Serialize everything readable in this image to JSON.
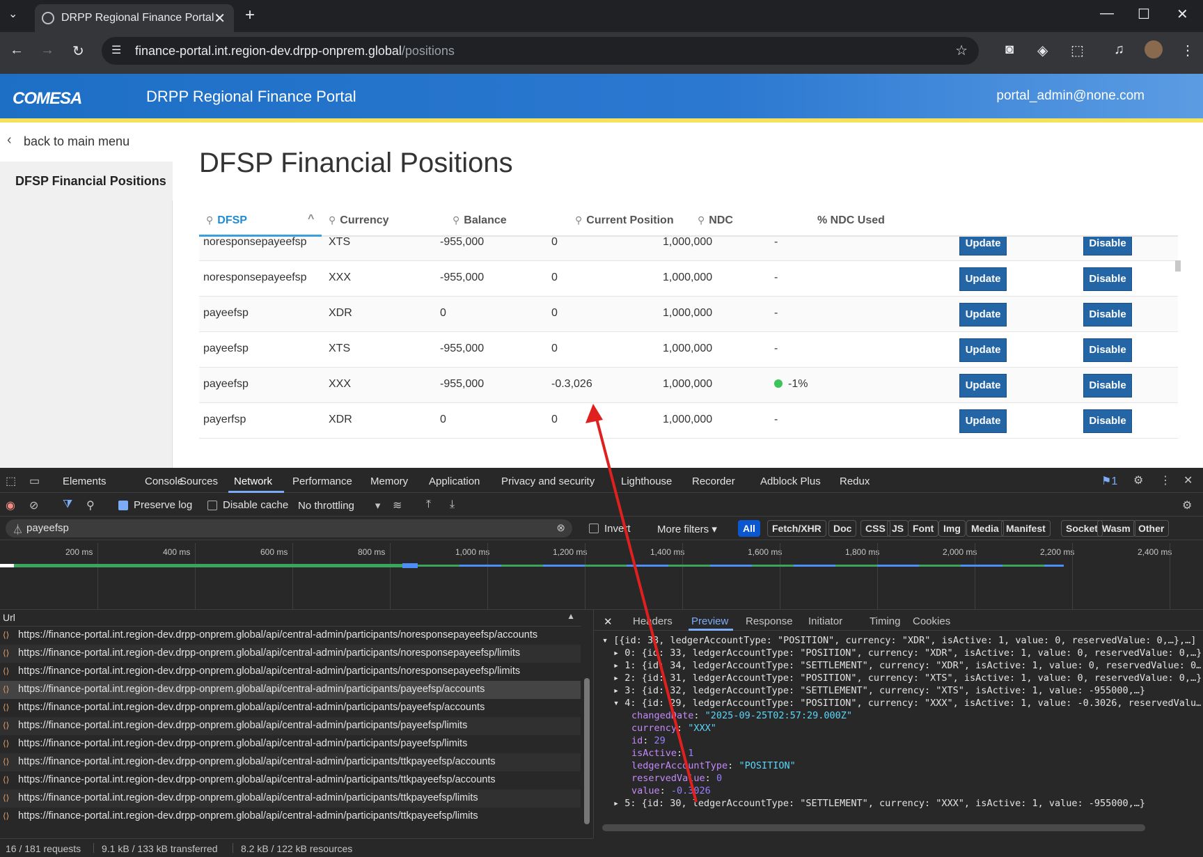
{
  "browser": {
    "tab_title": "DRPP Regional Finance Portal",
    "url_host": "finance-portal.int.region-dev.drpp-onprem.global",
    "url_path": "/positions"
  },
  "header": {
    "logo_text": "COMESA",
    "title": "DRPP Regional Finance Portal",
    "user": "portal_admin@none.com"
  },
  "sidebar": {
    "back_label": "back to main menu",
    "active_item": "DFSP Financial Positions"
  },
  "page": {
    "title": "DFSP Financial Positions"
  },
  "table": {
    "columns": [
      "DFSP",
      "Currency",
      "Balance",
      "Current Position",
      "NDC",
      "% NDC Used"
    ],
    "update_label": "Update",
    "disable_label": "Disable",
    "rows": [
      {
        "dfsp": "noresponsepayeefsp",
        "currency": "XTS",
        "balance": "-955,000",
        "position": "0",
        "ndc": "1,000,000",
        "ndc_used": "-"
      },
      {
        "dfsp": "noresponsepayeefsp",
        "currency": "XXX",
        "balance": "-955,000",
        "position": "0",
        "ndc": "1,000,000",
        "ndc_used": "-"
      },
      {
        "dfsp": "payeefsp",
        "currency": "XDR",
        "balance": "0",
        "position": "0",
        "ndc": "1,000,000",
        "ndc_used": "-"
      },
      {
        "dfsp": "payeefsp",
        "currency": "XTS",
        "balance": "-955,000",
        "position": "0",
        "ndc": "1,000,000",
        "ndc_used": "-"
      },
      {
        "dfsp": "payeefsp",
        "currency": "XXX",
        "balance": "-955,000",
        "position": "-0.3,026",
        "ndc": "1,000,000",
        "ndc_used": "-1%"
      },
      {
        "dfsp": "payerfsp",
        "currency": "XDR",
        "balance": "0",
        "position": "0",
        "ndc": "1,000,000",
        "ndc_used": "-"
      }
    ]
  },
  "devtools": {
    "tabs": [
      "Elements",
      "Console",
      "Sources",
      "Network",
      "Performance",
      "Memory",
      "Application",
      "Privacy and security",
      "Lighthouse",
      "Recorder",
      "Adblock Plus",
      "Redux"
    ],
    "active_tab": "Network",
    "issues_count": "1",
    "preserve_log": "Preserve log",
    "disable_cache": "Disable cache",
    "throttling": "No throttling",
    "filter_value": "payeefsp",
    "invert": "Invert",
    "more_filters": "More filters",
    "type_filters": [
      "All",
      "Fetch/XHR",
      "Doc",
      "CSS",
      "JS",
      "Font",
      "Img",
      "Media",
      "Manifest",
      "Socket",
      "Wasm",
      "Other"
    ],
    "timeline_ticks": [
      "200 ms",
      "400 ms",
      "600 ms",
      "800 ms",
      "1,000 ms",
      "1,200 ms",
      "1,400 ms",
      "1,600 ms",
      "1,800 ms",
      "2,000 ms",
      "2,200 ms",
      "2,400 ms"
    ],
    "url_header": "Url",
    "requests": [
      "https://finance-portal.int.region-dev.drpp-onprem.global/api/central-admin/participants/noresponsepayeefsp/accounts",
      "https://finance-portal.int.region-dev.drpp-onprem.global/api/central-admin/participants/noresponsepayeefsp/limits",
      "https://finance-portal.int.region-dev.drpp-onprem.global/api/central-admin/participants/noresponsepayeefsp/limits",
      "https://finance-portal.int.region-dev.drpp-onprem.global/api/central-admin/participants/payeefsp/accounts",
      "https://finance-portal.int.region-dev.drpp-onprem.global/api/central-admin/participants/payeefsp/accounts",
      "https://finance-portal.int.region-dev.drpp-onprem.global/api/central-admin/participants/payeefsp/limits",
      "https://finance-portal.int.region-dev.drpp-onprem.global/api/central-admin/participants/payeefsp/limits",
      "https://finance-portal.int.region-dev.drpp-onprem.global/api/central-admin/participants/ttkpayeefsp/accounts",
      "https://finance-portal.int.region-dev.drpp-onprem.global/api/central-admin/participants/ttkpayeefsp/accounts",
      "https://finance-portal.int.region-dev.drpp-onprem.global/api/central-admin/participants/ttkpayeefsp/limits",
      "https://finance-portal.int.region-dev.drpp-onprem.global/api/central-admin/participants/ttkpayeefsp/limits"
    ],
    "selected_request_index": 3,
    "preview_tabs": [
      "Headers",
      "Preview",
      "Response",
      "Initiator",
      "Timing",
      "Cookies"
    ],
    "active_preview_tab": "Preview",
    "json_lines": [
      "[{id: 33, ledgerAccountType: \"POSITION\", currency: \"XDR\", isActive: 1, value: 0, reservedValue: 0,…},…]",
      "0: {id: 33, ledgerAccountType: \"POSITION\", currency: \"XDR\", isActive: 1, value: 0, reservedValue: 0,…}",
      "1: {id: 34, ledgerAccountType: \"SETTLEMENT\", currency: \"XDR\", isActive: 1, value: 0, reservedValue: 0…",
      "2: {id: 31, ledgerAccountType: \"POSITION\", currency: \"XTS\", isActive: 1, value: 0, reservedValue: 0,…}",
      "3: {id: 32, ledgerAccountType: \"SETTLEMENT\", currency: \"XTS\", isActive: 1, value: -955000,…}",
      "4: {id: 29, ledgerAccountType: \"POSITION\", currency: \"XXX\", isActive: 1, value: -0.3026, reservedValu…",
      "5: {id: 30, ledgerAccountType: \"SETTLEMENT\", currency: \"XXX\", isActive: 1, value: -955000,…}"
    ],
    "expanded": [
      {
        "k": "changedDate",
        "v": "\"2025-09-25T02:57:29.000Z\"",
        "t": "str"
      },
      {
        "k": "currency",
        "v": "\"XXX\"",
        "t": "str"
      },
      {
        "k": "id",
        "v": "29",
        "t": "num"
      },
      {
        "k": "isActive",
        "v": "1",
        "t": "num"
      },
      {
        "k": "ledgerAccountType",
        "v": "\"POSITION\"",
        "t": "str"
      },
      {
        "k": "reservedValue",
        "v": "0",
        "t": "num"
      },
      {
        "k": "value",
        "v": "-0.3026",
        "t": "num"
      }
    ],
    "status_requests": "16 / 181 requests",
    "status_transferred": "9.1 kB / 133 kB transferred",
    "status_resources": "8.2 kB / 122 kB resources"
  },
  "colors": {
    "header_blue": "#2b78d1",
    "header_stripe": "#f4e25a",
    "button_blue": "#2465a6",
    "annotation_arrow": "#e0201f",
    "ndc_dot": "#3cc35a"
  }
}
